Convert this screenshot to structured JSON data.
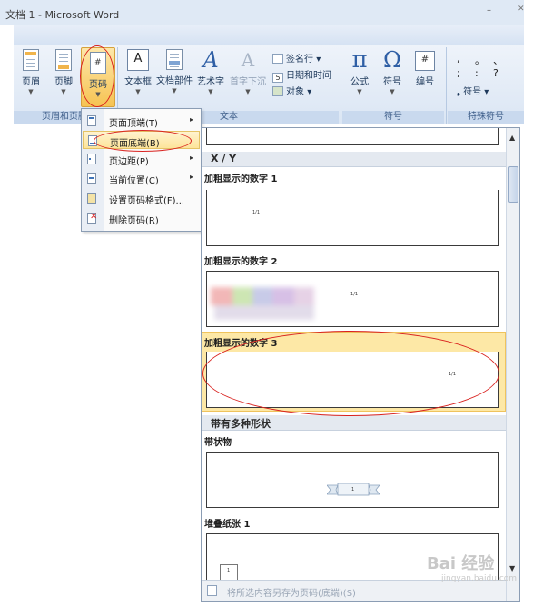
{
  "window": {
    "title": "文档 1 - Microsoft Word",
    "minimize_glyph": "–",
    "close_glyph": "✕"
  },
  "ribbon": {
    "header_footer_group": {
      "label": "页眉和页脚",
      "buttons": [
        {
          "label": "页眉",
          "icon": "header-icon"
        },
        {
          "label": "页脚",
          "icon": "footer-icon"
        },
        {
          "label": "页码",
          "icon": "page-number-icon",
          "icon_text": "#"
        }
      ]
    },
    "text_group": {
      "label": "文本",
      "buttons": [
        {
          "label": "文本框",
          "icon": "textbox-icon",
          "icon_text": "A"
        },
        {
          "label": "文档部件",
          "icon": "quick-parts-icon"
        },
        {
          "label": "艺术字",
          "icon": "wordart-icon",
          "icon_text": "A"
        },
        {
          "label": "首字下沉",
          "icon": "drop-cap-icon",
          "icon_text": "A"
        }
      ],
      "small_commands": [
        {
          "label": "签名行",
          "icon": "signature-line-icon",
          "dropdown": "▾"
        },
        {
          "label": "日期和时间",
          "icon": "date-time-icon",
          "icon_text": "5"
        },
        {
          "label": "对象",
          "icon": "object-icon",
          "dropdown": "▾"
        }
      ]
    },
    "symbols_group": {
      "label": "符号",
      "buttons": [
        {
          "label": "公式",
          "icon": "equation-icon",
          "icon_text": "π"
        },
        {
          "label": "符号",
          "icon": "symbol-icon",
          "icon_text": "Ω"
        },
        {
          "label": "编号",
          "icon": "numbering-icon",
          "icon_text": "#"
        }
      ]
    },
    "special_symbols_group": {
      "label": "特殊符号",
      "glyphs": [
        ",",
        "。",
        "、",
        ";",
        ":",
        "?"
      ],
      "button": {
        "label": "符号",
        "prefix": "❟",
        "dropdown": "▾"
      }
    }
  },
  "page_number_menu": {
    "items": [
      {
        "label": "页面顶端(T)",
        "submenu": "▸",
        "highlighted": false
      },
      {
        "label": "页面底端(B)",
        "submenu": "",
        "highlighted": true
      },
      {
        "label": "页边距(P)",
        "submenu": "▸",
        "highlighted": false
      },
      {
        "label": "当前位置(C)",
        "submenu": "▸",
        "highlighted": false
      },
      {
        "label": "设置页码格式(F)...",
        "submenu": "",
        "highlighted": false
      },
      {
        "label": "删除页码(R)",
        "submenu": "",
        "highlighted": false
      }
    ]
  },
  "gallery": {
    "scroll_up": "▲",
    "scroll_down": "▼",
    "sections": [
      {
        "header": "X / Y"
      },
      {
        "header": "带有多种形状"
      }
    ],
    "items": [
      {
        "title": "加粗显示的数字 1",
        "page_label": "1/1"
      },
      {
        "title": "加粗显示的数字 2",
        "page_label": "1/1"
      },
      {
        "title": "加粗显示的数字 3",
        "page_label": "1/1",
        "highlighted": true
      },
      {
        "title": "带状物",
        "page_label": "1"
      },
      {
        "title": "堆叠纸张 1",
        "page_label": "1"
      }
    ],
    "footer": "将所选内容另存为页码(底端)(S)"
  },
  "watermark": {
    "text": "Bai 经验",
    "sub": "jingyan.baidu.com"
  }
}
